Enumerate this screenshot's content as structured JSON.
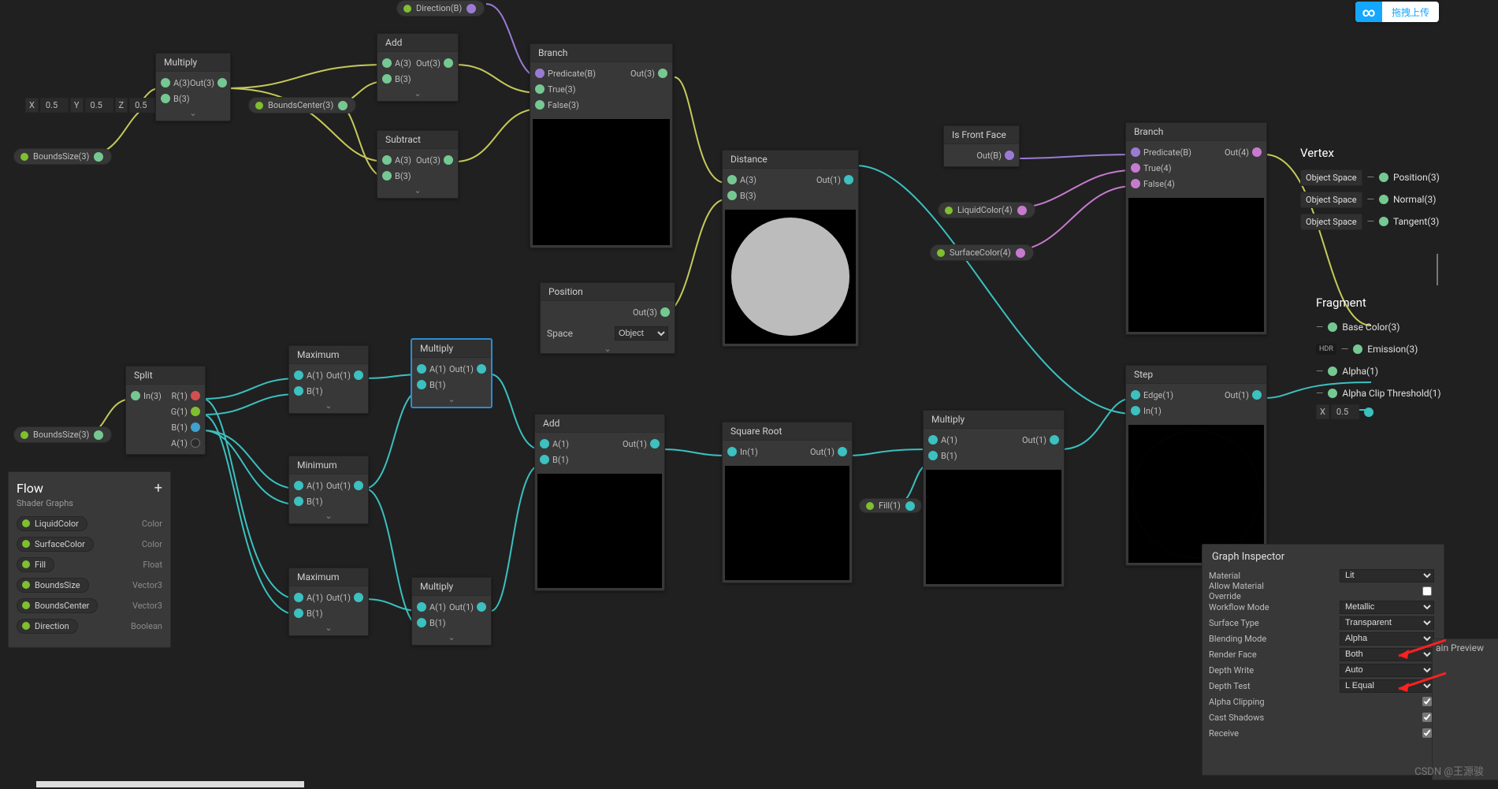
{
  "upload_button": "拖拽上传",
  "watermark": "CSDN @王源骏",
  "vec_input": {
    "x_lbl": "X",
    "x_val": "0.5",
    "y_lbl": "Y",
    "y_val": "0.5",
    "z_lbl": "Z",
    "z_val": "0.5"
  },
  "alpha_clip": {
    "lbl": "X",
    "val": "0.5"
  },
  "pills": {
    "bounds_size_1": "BoundsSize(3)",
    "bounds_center": "BoundsCenter(3)",
    "bounds_size_2": "BoundsSize(3)",
    "direction": "Direction(B)",
    "liquid_color": "LiquidColor(4)",
    "surface_color": "SurfaceColor(4)",
    "fill": "Fill(1)"
  },
  "nodes": {
    "multiply1": {
      "title": "Multiply",
      "a": "A(3)",
      "b": "B(3)",
      "out": "Out(3)"
    },
    "add1": {
      "title": "Add",
      "a": "A(3)",
      "b": "B(3)",
      "out": "Out(3)"
    },
    "subtract": {
      "title": "Subtract",
      "a": "A(3)",
      "b": "B(3)",
      "out": "Out(3)"
    },
    "branch1": {
      "title": "Branch",
      "p": "Predicate(B)",
      "t": "True(3)",
      "f": "False(3)",
      "out": "Out(3)"
    },
    "position": {
      "title": "Position",
      "out": "Out(3)",
      "space_lbl": "Space",
      "space_val": "Object"
    },
    "distance": {
      "title": "Distance",
      "a": "A(3)",
      "b": "B(3)",
      "out": "Out(1)"
    },
    "isfront": {
      "title": "Is Front Face",
      "out": "Out(B)"
    },
    "branch2": {
      "title": "Branch",
      "p": "Predicate(B)",
      "t": "True(4)",
      "f": "False(4)",
      "out": "Out(4)"
    },
    "split": {
      "title": "Split",
      "in": "In(3)",
      "r": "R(1)",
      "g": "G(1)",
      "b": "B(1)",
      "a": "A(1)"
    },
    "max1": {
      "title": "Maximum",
      "a": "A(1)",
      "b": "B(1)",
      "out": "Out(1)"
    },
    "min1": {
      "title": "Minimum",
      "a": "A(1)",
      "b": "B(1)",
      "out": "Out(1)"
    },
    "max2": {
      "title": "Maximum",
      "a": "A(1)",
      "b": "B(1)",
      "out": "Out(1)"
    },
    "multiply2": {
      "title": "Multiply",
      "a": "A(1)",
      "b": "B(1)",
      "out": "Out(1)"
    },
    "multiply3": {
      "title": "Multiply",
      "a": "A(1)",
      "b": "B(1)",
      "out": "Out(1)"
    },
    "add2": {
      "title": "Add",
      "a": "A(1)",
      "b": "B(1)",
      "out": "Out(1)"
    },
    "sqrt": {
      "title": "Square Root",
      "in": "In(1)",
      "out": "Out(1)"
    },
    "multiply4": {
      "title": "Multiply",
      "a": "A(1)",
      "b": "B(1)",
      "out": "Out(1)"
    },
    "step": {
      "title": "Step",
      "edge": "Edge(1)",
      "in": "In(1)",
      "out": "Out(1)"
    }
  },
  "vertex": {
    "title": "Vertex",
    "rows": [
      {
        "space": "Object Space",
        "slot": "Position(3)"
      },
      {
        "space": "Object Space",
        "slot": "Normal(3)"
      },
      {
        "space": "Object Space",
        "slot": "Tangent(3)"
      }
    ]
  },
  "fragment": {
    "title": "Fragment",
    "rows": [
      {
        "slot": "Base Color(3)"
      },
      {
        "slot": "Emission(3)",
        "hdr": true
      },
      {
        "slot": "Alpha(1)"
      },
      {
        "slot": "Alpha Clip Threshold(1)"
      }
    ]
  },
  "flow": {
    "title": "Flow",
    "sub": "Shader Graphs",
    "plus": "+",
    "items": [
      {
        "name": "LiquidColor",
        "type": "Color",
        "dot": "g"
      },
      {
        "name": "SurfaceColor",
        "type": "Color",
        "dot": "g"
      },
      {
        "name": "Fill",
        "type": "Float",
        "dot": "g"
      },
      {
        "name": "BoundsSize",
        "type": "Vector3",
        "dot": "g"
      },
      {
        "name": "BoundsCenter",
        "type": "Vector3",
        "dot": "g"
      },
      {
        "name": "Direction",
        "type": "Boolean",
        "dot": "g"
      }
    ]
  },
  "inspector": {
    "title": "Graph Inspector",
    "rows": [
      {
        "label": "Material",
        "kind": "sel",
        "value": "Lit"
      },
      {
        "label": "Allow Material Override",
        "kind": "chk",
        "value": false
      },
      {
        "label": "Workflow Mode",
        "kind": "sel",
        "value": "Metallic"
      },
      {
        "label": "Surface Type",
        "kind": "sel",
        "value": "Transparent"
      },
      {
        "label": "Blending Mode",
        "kind": "sel",
        "value": "Alpha"
      },
      {
        "label": "Render Face",
        "kind": "sel",
        "value": "Both"
      },
      {
        "label": "Depth Write",
        "kind": "sel",
        "value": "Auto"
      },
      {
        "label": "Depth Test",
        "kind": "sel",
        "value": "L Equal"
      },
      {
        "label": "Alpha Clipping",
        "kind": "chk",
        "value": true
      },
      {
        "label": "Cast Shadows",
        "kind": "chk",
        "value": true
      },
      {
        "label": "Receive",
        "kind": "chk",
        "value": true
      }
    ]
  },
  "preview_pane": "ain Preview"
}
